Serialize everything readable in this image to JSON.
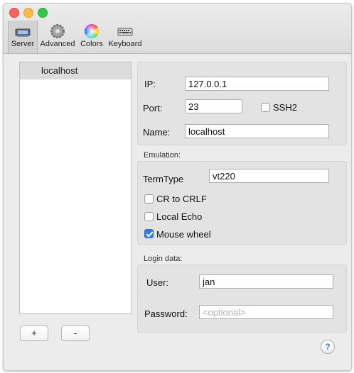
{
  "toolbar": {
    "items": [
      {
        "label": "Server",
        "icon": "server-icon"
      },
      {
        "label": "Advanced",
        "icon": "gear-icon"
      },
      {
        "label": "Colors",
        "icon": "color-wheel-icon"
      },
      {
        "label": "Keyboard",
        "icon": "keyboard-icon"
      }
    ],
    "selected": "Server"
  },
  "servers": {
    "items": [
      "localhost"
    ],
    "add_label": "+",
    "remove_label": "-"
  },
  "server": {
    "ip_label": "IP:",
    "ip_value": "127.0.0.1",
    "port_label": "Port:",
    "port_value": "23",
    "ssh_label": "SSH2",
    "ssh_checked": false,
    "name_label": "Name:",
    "name_value": "localhost"
  },
  "emulation": {
    "title": "Emulation:",
    "termtype_label": "TermType",
    "termtype_value": "vt220",
    "cr_label": "CR to CRLF",
    "cr_checked": false,
    "echo_label": "Local Echo",
    "echo_checked": false,
    "wheel_label": "Mouse wheel",
    "wheel_checked": true
  },
  "login": {
    "title": "Login data:",
    "user_label": "User:",
    "user_value": "jan",
    "password_label": "Password:",
    "password_placeholder": "<optional>"
  },
  "help_label": "?",
  "colors": {
    "checkbox_accent": "#2f7ff2",
    "help_accent": "#3b7ddd"
  }
}
